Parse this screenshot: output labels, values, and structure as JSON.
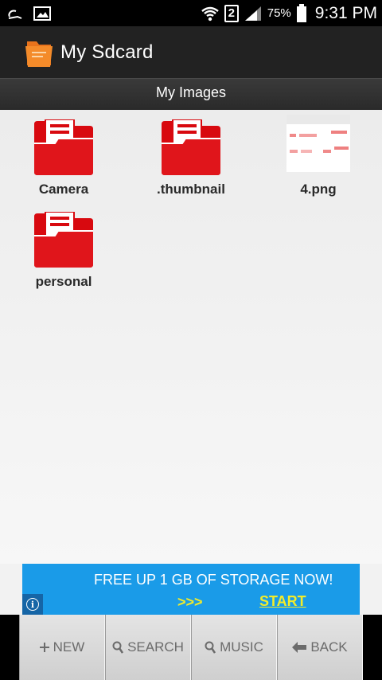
{
  "status_bar": {
    "sim": "2",
    "battery": "75%",
    "time": "9:31 PM"
  },
  "app_bar": {
    "title": "My Sdcard"
  },
  "sub_header": {
    "title": "My Images"
  },
  "files": [
    {
      "name": "Camera",
      "type": "folder"
    },
    {
      "name": ".thumbnail",
      "type": "folder"
    },
    {
      "name": "4.png",
      "type": "image"
    },
    {
      "name": "personal",
      "type": "folder"
    }
  ],
  "ad": {
    "headline": "FREE UP 1 GB OF STORAGE NOW!",
    "arrows": ">>>",
    "cta": "START"
  },
  "toolbar": {
    "new_label": "NEW",
    "search_label": "SEARCH",
    "music_label": "MUSIC",
    "back_label": "BACK"
  },
  "colors": {
    "folder_red": "#d8090f",
    "ad_blue": "#1a9be8",
    "ad_yellow": "#f3ec2a"
  }
}
